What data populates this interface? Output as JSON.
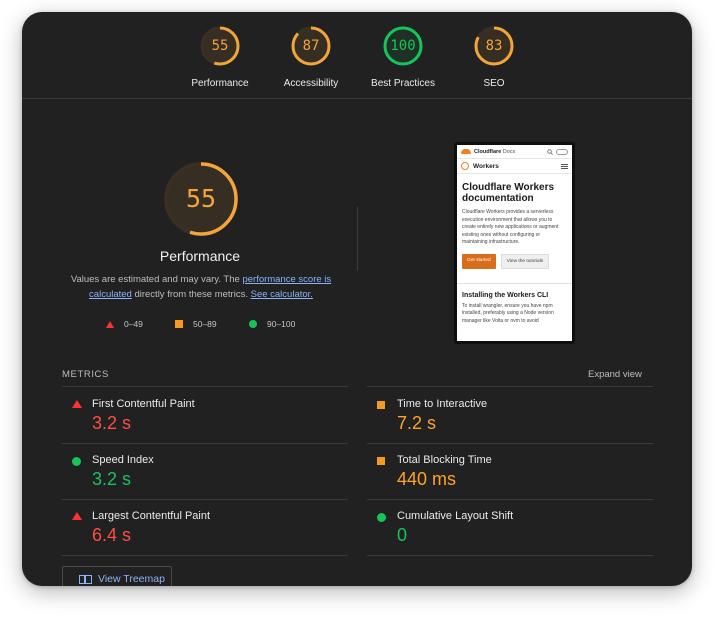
{
  "gauges": [
    {
      "label": "Performance",
      "score": "55",
      "fraction": 0.55,
      "color": "#f3a43b"
    },
    {
      "label": "Accessibility",
      "score": "87",
      "fraction": 0.87,
      "color": "#f3a43b"
    },
    {
      "label": "Best Practices",
      "score": "100",
      "fraction": 1.0,
      "color": "#17c45a"
    },
    {
      "label": "SEO",
      "score": "83",
      "fraction": 0.83,
      "color": "#f3a43b"
    }
  ],
  "main": {
    "score": "55",
    "fraction": 0.55,
    "title": "Performance",
    "desc_prefix": "Values are estimated and may vary. The ",
    "desc_link1": "performance score is calculated",
    "desc_middle": " directly from these metrics. ",
    "desc_link2": "See calculator."
  },
  "legend": {
    "fail": "0–49",
    "average": "50–89",
    "pass": "90–100"
  },
  "preview": {
    "brand": "Cloudflare",
    "brand_suffix": "Docs",
    "section": "Workers",
    "heading": "Cloudflare Workers documentation",
    "intro": "Cloudflare Workers provides a serverless execution environment that allows you to create entirely new applications or augment existing ones without configuring or maintaining infrastructure.",
    "btn_primary": "Get started",
    "btn_secondary": "View the tutorials",
    "subheading": "Installing the Workers CLI",
    "install_text": "To install wrangler, ensure you have npm installed, preferably using a Node version manager like Volta or nvm to avoid"
  },
  "metrics": {
    "title": "METRICS",
    "expand_label": "Expand view",
    "items": [
      {
        "label": "First Contentful Paint",
        "value": "3.2 s",
        "status": "fail"
      },
      {
        "label": "Time to Interactive",
        "value": "7.2 s",
        "status": "average"
      },
      {
        "label": "Speed Index",
        "value": "3.2 s",
        "status": "pass"
      },
      {
        "label": "Total Blocking Time",
        "value": "440 ms",
        "status": "average"
      },
      {
        "label": "Largest Contentful Paint",
        "value": "6.4 s",
        "status": "fail"
      },
      {
        "label": "Cumulative Layout Shift",
        "value": "0",
        "status": "pass"
      }
    ]
  },
  "treemap_label": "View Treemap"
}
